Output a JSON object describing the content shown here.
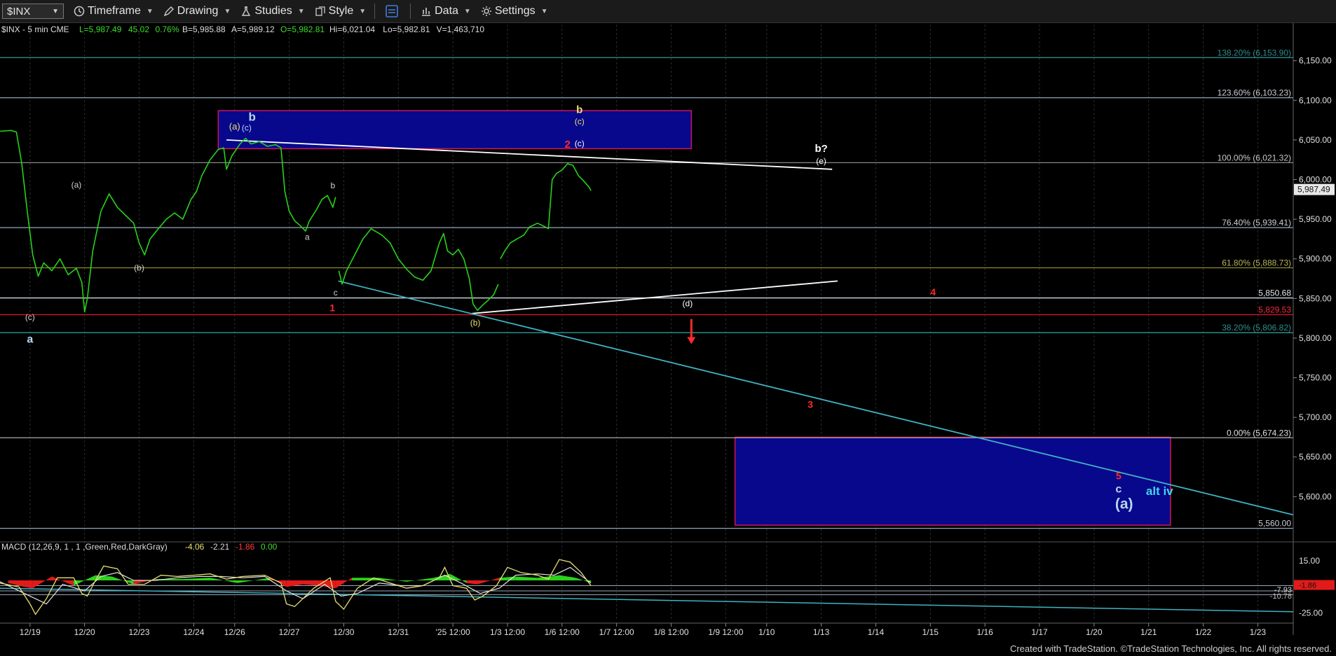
{
  "toolbar": {
    "symbol": "$INX",
    "timeframe": "Timeframe",
    "drawing": "Drawing",
    "studies": "Studies",
    "style": "Style",
    "data": "Data",
    "settings": "Settings"
  },
  "chart_data": {
    "type": "line",
    "header": "$INX - 5 min  CME",
    "stats": [
      {
        "text": "L=5,987.49",
        "color": "#3ddc2a"
      },
      {
        "text": "45.02",
        "color": "#3ddc2a"
      },
      {
        "text": "0.76%",
        "color": "#3ddc2a"
      },
      {
        "text": "B=5,985.88",
        "color": "#dddddd"
      },
      {
        "text": "A=5,989.12",
        "color": "#dddddd"
      },
      {
        "text": "O=5,982.81",
        "color": "#3ddc2a"
      },
      {
        "text": "Hi=6,021.04",
        "color": "#dddddd"
      },
      {
        "text": "Lo=5,982.81",
        "color": "#dddddd"
      },
      {
        "text": "V=1,463,710",
        "color": "#dddddd"
      }
    ],
    "xticks": [
      {
        "label": "12/19",
        "x": 0
      },
      {
        "label": "12/20",
        "x": 1
      },
      {
        "label": "12/23",
        "x": 2
      },
      {
        "label": "12/24",
        "x": 3
      },
      {
        "label": "12/26",
        "x": 3.75
      },
      {
        "label": "12/27",
        "x": 4.75
      },
      {
        "label": "12/30",
        "x": 5.75
      },
      {
        "label": "12/31",
        "x": 6.75
      },
      {
        "label": "'25 12:00",
        "x": 7.75
      },
      {
        "label": "1/3 12:00",
        "x": 8.75
      },
      {
        "label": "1/6 12:00",
        "x": 9.75
      },
      {
        "label": "1/7 12:00",
        "x": 10.75
      },
      {
        "label": "1/8 12:00",
        "x": 11.75
      },
      {
        "label": "1/9 12:00",
        "x": 12.75
      },
      {
        "label": "1/10",
        "x": 13.5
      },
      {
        "label": "1/13",
        "x": 14.5
      },
      {
        "label": "1/14",
        "x": 15.5
      },
      {
        "label": "1/15",
        "x": 16.5
      },
      {
        "label": "1/16",
        "x": 17.5
      },
      {
        "label": "1/17",
        "x": 18.5
      },
      {
        "label": "1/20",
        "x": 19.5
      },
      {
        "label": "1/21",
        "x": 20.5
      },
      {
        "label": "1/22",
        "x": 21.5
      },
      {
        "label": "1/23",
        "x": 22.5
      }
    ],
    "xlim": [
      -0.55,
      23.15
    ],
    "ylim": [
      5542,
      6178
    ],
    "yticks": [
      {
        "label": "6,150.00",
        "y": 6150
      },
      {
        "label": "6,100.00",
        "y": 6100
      },
      {
        "label": "6,050.00",
        "y": 6050
      },
      {
        "label": "6,000.00",
        "y": 6000
      },
      {
        "label": "5,950.00",
        "y": 5950
      },
      {
        "label": "5,900.00",
        "y": 5900
      },
      {
        "label": "5,850.00",
        "y": 5850
      },
      {
        "label": "5,800.00",
        "y": 5800
      },
      {
        "label": "5,750.00",
        "y": 5750
      },
      {
        "label": "5,700.00",
        "y": 5700
      },
      {
        "label": "5,650.00",
        "y": 5650
      },
      {
        "label": "5,600.00",
        "y": 5600
      }
    ],
    "last_price": {
      "label": "5,987.49",
      "y": 5987.49
    },
    "fib_levels": [
      {
        "label": "138.20% (6,153.90)",
        "y": 6153.9,
        "color": "#2a9a98",
        "text_color": "#2f8f8c"
      },
      {
        "label": "123.60% (6,103.23)",
        "y": 6103.23,
        "color": "#8aa6bd",
        "text_color": "#c9ced4"
      },
      {
        "label": "100.00% (6,021.32)",
        "y": 6021.32,
        "color": "#888888",
        "text_color": "#c8c8c8"
      },
      {
        "label": "76.40% (5,939.41)",
        "y": 5939.41,
        "color": "#95a8bc",
        "text_color": "#c9ced4"
      },
      {
        "label": "61.80% (5,888.73)",
        "y": 5888.73,
        "color": "#8e8a2a",
        "text_color": "#b8b35a"
      },
      {
        "label": "5,850.68",
        "y": 5850.68,
        "color": "#cfdbe6",
        "text_color": "#e0e6ec"
      },
      {
        "label": "5,829.53",
        "y": 5829.53,
        "color": "#e3132b",
        "text_color": "#ff2a3b"
      },
      {
        "label": "38.20% (5,806.82)",
        "y": 5806.82,
        "color": "#2a9a98",
        "text_color": "#2f8f8c"
      },
      {
        "label": "0.00% (5,674.23)",
        "y": 5674.23,
        "color": "#9a9a9a",
        "text_color": "#e0e0e0"
      },
      {
        "label": "5,560.00",
        "y": 5560,
        "color": "#8aa6bd",
        "text_color": "#c9ced4"
      }
    ],
    "zones": [
      {
        "x1": 3.45,
        "x2": 12.12,
        "y1": 6039,
        "y2": 6087
      },
      {
        "x1": 12.92,
        "x2": 20.9,
        "y1": 5564,
        "y2": 5675
      }
    ],
    "trendlines": [
      {
        "x1": 3.6,
        "y1": 6050,
        "x2": 14.7,
        "y2": 6013,
        "color": "#ffffff"
      },
      {
        "x1": 8.1,
        "y1": 5831,
        "x2": 14.8,
        "y2": 5872,
        "color": "#ffffff"
      },
      {
        "x1": 5.65,
        "y1": 5872,
        "x2": 23.15,
        "y2": 5577,
        "color": "#3fb2c2"
      }
    ],
    "price": [
      [
        -0.55,
        6061
      ],
      [
        -0.35,
        6062
      ],
      [
        -0.25,
        6060
      ],
      [
        -0.15,
        6020
      ],
      [
        -0.05,
        5960
      ],
      [
        0.05,
        5905
      ],
      [
        0.15,
        5878
      ],
      [
        0.25,
        5895
      ],
      [
        0.4,
        5885
      ],
      [
        0.55,
        5900
      ],
      [
        0.7,
        5880
      ],
      [
        0.85,
        5888
      ],
      [
        0.95,
        5870
      ],
      [
        1.0,
        5833
      ],
      [
        1.05,
        5850
      ],
      [
        1.15,
        5910
      ],
      [
        1.3,
        5960
      ],
      [
        1.45,
        5982
      ],
      [
        1.6,
        5965
      ],
      [
        1.75,
        5955
      ],
      [
        1.9,
        5945
      ],
      [
        2.0,
        5920
      ],
      [
        2.1,
        5905
      ],
      [
        2.2,
        5925
      ],
      [
        2.35,
        5938
      ],
      [
        2.5,
        5950
      ],
      [
        2.65,
        5958
      ],
      [
        2.8,
        5950
      ],
      [
        2.95,
        5975
      ],
      [
        3.05,
        5985
      ],
      [
        3.15,
        6005
      ],
      [
        3.3,
        6025
      ],
      [
        3.45,
        6038
      ],
      [
        3.55,
        6040
      ],
      [
        3.6,
        6013
      ],
      [
        3.7,
        6030
      ],
      [
        3.85,
        6045
      ],
      [
        3.95,
        6052
      ],
      [
        4.05,
        6045
      ],
      [
        4.2,
        6048
      ],
      [
        4.35,
        6042
      ],
      [
        4.5,
        6044
      ],
      [
        4.6,
        6040
      ],
      [
        4.67,
        5985
      ],
      [
        4.75,
        5960
      ],
      [
        4.85,
        5948
      ],
      [
        4.95,
        5942
      ],
      [
        5.05,
        5935
      ],
      [
        5.12,
        5948
      ],
      [
        5.25,
        5962
      ],
      [
        5.35,
        5975
      ],
      [
        5.45,
        5980
      ],
      [
        5.55,
        5965
      ],
      [
        5.6,
        5978
      ],
      [
        5.62,
        5930
      ],
      [
        5.66,
        5885
      ],
      [
        5.72,
        5868
      ],
      [
        5.8,
        5885
      ],
      [
        5.95,
        5905
      ],
      [
        6.1,
        5925
      ],
      [
        6.25,
        5938
      ],
      [
        6.45,
        5930
      ],
      [
        6.6,
        5920
      ],
      [
        6.75,
        5900
      ],
      [
        6.9,
        5887
      ],
      [
        7.05,
        5877
      ],
      [
        7.2,
        5873
      ],
      [
        7.35,
        5885
      ],
      [
        7.5,
        5920
      ],
      [
        7.58,
        5932
      ],
      [
        7.65,
        5910
      ],
      [
        7.75,
        5905
      ],
      [
        7.85,
        5912
      ],
      [
        7.95,
        5900
      ],
      [
        8.05,
        5875
      ],
      [
        8.12,
        5843
      ],
      [
        8.2,
        5835
      ],
      [
        8.3,
        5842
      ],
      [
        8.4,
        5848
      ],
      [
        8.5,
        5855
      ],
      [
        8.58,
        5868
      ],
      [
        8.62,
        5900
      ],
      [
        8.7,
        5910
      ],
      [
        8.8,
        5920
      ],
      [
        8.92,
        5925
      ],
      [
        9.05,
        5930
      ],
      [
        9.15,
        5940
      ],
      [
        9.3,
        5945
      ],
      [
        9.45,
        5940
      ],
      [
        9.5,
        5938
      ],
      [
        9.57,
        6000
      ],
      [
        9.65,
        6008
      ],
      [
        9.75,
        6012
      ],
      [
        9.85,
        6020
      ],
      [
        9.95,
        6018
      ],
      [
        10.05,
        6005
      ],
      [
        10.15,
        5998
      ],
      [
        10.25,
        5990
      ],
      [
        10.28,
        5986
      ]
    ],
    "macd": {
      "title": "MACD (12,26,9, 1 , 1 ,Green,Red,DarkGray)",
      "values": [
        {
          "text": "-4.06",
          "color": "#e8e070"
        },
        {
          "text": "-2.21",
          "color": "#d8d8d8"
        },
        {
          "text": "-1.86",
          "color": "#ff3b3b"
        },
        {
          "text": "0.00",
          "color": "#3ddc2a"
        }
      ],
      "ylim": [
        -30,
        22
      ],
      "yticks": [
        {
          "label": "15.00",
          "y": 15
        },
        {
          "label": "-25.00",
          "y": -25
        }
      ],
      "badge_levels": [
        {
          "label": "-7.93",
          "y": -7.93
        },
        {
          "label": "-10.78",
          "y": -10.78
        },
        {
          "label": "-1.86",
          "y": -1.86
        }
      ],
      "levels": [
        -4,
        -8,
        -11
      ],
      "trend": {
        "x1": -0.55,
        "y1": -6,
        "x2": 23.15,
        "y2": -24
      },
      "line": [
        [
          -0.55,
          -2
        ],
        [
          -0.2,
          -5
        ],
        [
          0.0,
          -18
        ],
        [
          0.1,
          -26
        ],
        [
          0.3,
          -14
        ],
        [
          0.5,
          2
        ],
        [
          0.8,
          2
        ],
        [
          0.95,
          -10
        ],
        [
          1.05,
          -12
        ],
        [
          1.2,
          0
        ],
        [
          1.35,
          11
        ],
        [
          1.6,
          9
        ],
        [
          1.8,
          -3
        ],
        [
          2.1,
          -3
        ],
        [
          2.4,
          4
        ],
        [
          2.7,
          3
        ],
        [
          3.0,
          4
        ],
        [
          3.3,
          5
        ],
        [
          3.6,
          1
        ],
        [
          3.9,
          3
        ],
        [
          4.3,
          4
        ],
        [
          4.6,
          -2
        ],
        [
          4.7,
          -18
        ],
        [
          4.85,
          -20
        ],
        [
          5.2,
          -6
        ],
        [
          5.5,
          2
        ],
        [
          5.6,
          -16
        ],
        [
          5.75,
          -22
        ],
        [
          6.0,
          -6
        ],
        [
          6.3,
          2
        ],
        [
          6.6,
          -2
        ],
        [
          6.9,
          -6
        ],
        [
          7.2,
          -4
        ],
        [
          7.5,
          2
        ],
        [
          7.6,
          10
        ],
        [
          7.75,
          -4
        ],
        [
          8.0,
          -6
        ],
        [
          8.15,
          -15
        ],
        [
          8.3,
          -12
        ],
        [
          8.55,
          -4
        ],
        [
          8.75,
          10
        ],
        [
          9.0,
          6
        ],
        [
          9.3,
          4
        ],
        [
          9.5,
          1
        ],
        [
          9.7,
          16
        ],
        [
          9.9,
          14
        ],
        [
          10.1,
          6
        ],
        [
          10.28,
          -4
        ]
      ],
      "signal": [
        [
          -0.55,
          -1
        ],
        [
          0.0,
          -12
        ],
        [
          0.3,
          -18
        ],
        [
          0.6,
          -3
        ],
        [
          1.0,
          -8
        ],
        [
          1.3,
          3
        ],
        [
          1.6,
          6
        ],
        [
          1.9,
          0
        ],
        [
          2.3,
          0
        ],
        [
          2.7,
          2
        ],
        [
          3.1,
          3
        ],
        [
          3.5,
          3
        ],
        [
          3.9,
          2
        ],
        [
          4.3,
          3
        ],
        [
          4.7,
          -8
        ],
        [
          5.0,
          -14
        ],
        [
          5.4,
          -3
        ],
        [
          5.7,
          -12
        ],
        [
          6.0,
          -10
        ],
        [
          6.4,
          -2
        ],
        [
          6.8,
          -4
        ],
        [
          7.2,
          -4
        ],
        [
          7.6,
          4
        ],
        [
          7.9,
          -2
        ],
        [
          8.25,
          -10
        ],
        [
          8.6,
          -6
        ],
        [
          8.9,
          4
        ],
        [
          9.3,
          5
        ],
        [
          9.6,
          4
        ],
        [
          9.9,
          10
        ],
        [
          10.28,
          -2
        ]
      ],
      "hist": [
        [
          -0.4,
          -2
        ],
        [
          -0.1,
          -5
        ],
        [
          0.05,
          -6
        ],
        [
          0.4,
          3
        ],
        [
          0.8,
          -4
        ],
        [
          1.2,
          4
        ],
        [
          1.5,
          3
        ],
        [
          1.9,
          -3
        ],
        [
          2.3,
          1
        ],
        [
          2.8,
          1
        ],
        [
          3.3,
          2
        ],
        [
          3.8,
          -2
        ],
        [
          4.4,
          2
        ],
        [
          4.7,
          -5
        ],
        [
          5.0,
          -3
        ],
        [
          5.3,
          -4
        ],
        [
          5.6,
          -6
        ],
        [
          5.9,
          2
        ],
        [
          6.4,
          2
        ],
        [
          6.9,
          -1
        ],
        [
          7.4,
          2
        ],
        [
          7.7,
          5
        ],
        [
          8.0,
          -2
        ],
        [
          8.2,
          -3
        ],
        [
          8.6,
          2
        ],
        [
          8.9,
          3
        ],
        [
          9.3,
          2
        ],
        [
          9.7,
          4
        ],
        [
          10.0,
          2
        ],
        [
          10.28,
          -2
        ]
      ]
    },
    "annotations": [
      {
        "text": "a",
        "x": 0.0,
        "y": 5794,
        "color": "#b7d6f0",
        "size": 16,
        "bold": true
      },
      {
        "text": "(c)",
        "x": 0.0,
        "y": 5823,
        "color": "#cfcfcf",
        "size": 12
      },
      {
        "text": "(a)",
        "x": 0.85,
        "y": 5990,
        "color": "#cfcfcf",
        "size": 12
      },
      {
        "text": "(b)",
        "x": 2.0,
        "y": 5885,
        "color": "#cfcfcf",
        "size": 12
      },
      {
        "text": "(a)",
        "x": 3.75,
        "y": 6063,
        "color": "#e8e070",
        "size": 13
      },
      {
        "text": "(c)",
        "x": 3.97,
        "y": 6062,
        "color": "#b7d6f0",
        "size": 12
      },
      {
        "text": "b",
        "x": 4.07,
        "y": 6074,
        "color": "#b7d6f0",
        "size": 17,
        "bold": true
      },
      {
        "text": "b",
        "x": 5.55,
        "y": 5989,
        "color": "#cfcfcf",
        "size": 12
      },
      {
        "text": "a",
        "x": 5.08,
        "y": 5924,
        "color": "#cfcfcf",
        "size": 12
      },
      {
        "text": "c",
        "x": 5.6,
        "y": 5854,
        "color": "#cfcfcf",
        "size": 12
      },
      {
        "text": "1",
        "x": 5.54,
        "y": 5834,
        "color": "#ff2a2a",
        "size": 14,
        "bold": true
      },
      {
        "text": "(b)",
        "x": 8.16,
        "y": 5816,
        "color": "#e8e070",
        "size": 12
      },
      {
        "text": "b",
        "x": 10.07,
        "y": 6084,
        "color": "#e8e070",
        "size": 15,
        "bold": true
      },
      {
        "text": "(c)",
        "x": 10.07,
        "y": 6070,
        "color": "#e8e070",
        "size": 12
      },
      {
        "text": "2",
        "x": 9.85,
        "y": 6040,
        "color": "#ff2a2a",
        "size": 15,
        "bold": true
      },
      {
        "text": "(c)",
        "x": 10.07,
        "y": 6042,
        "color": "#ffffff",
        "size": 12
      },
      {
        "text": "b?",
        "x": 14.5,
        "y": 6035,
        "color": "#ffffff",
        "size": 15,
        "bold": true
      },
      {
        "text": "(e)",
        "x": 14.5,
        "y": 6020,
        "color": "#ffffff",
        "size": 12
      },
      {
        "text": "(d)",
        "x": 12.05,
        "y": 5840,
        "color": "#ffffff",
        "size": 12
      },
      {
        "text": "4",
        "x": 16.55,
        "y": 5854,
        "color": "#ff2a2a",
        "size": 14,
        "bold": true
      },
      {
        "text": "3",
        "x": 14.3,
        "y": 5712,
        "color": "#ff2a2a",
        "size": 14,
        "bold": true
      },
      {
        "text": "5",
        "x": 19.95,
        "y": 5622,
        "color": "#ff2a2a",
        "size": 14,
        "bold": true
      },
      {
        "text": "c",
        "x": 19.95,
        "y": 5605,
        "color": "#b7d6f0",
        "size": 16,
        "bold": true
      },
      {
        "text": "(a)",
        "x": 20.05,
        "y": 5585,
        "color": "#b7d6f0",
        "size": 21,
        "bold": true
      },
      {
        "text": "alt iv",
        "x": 20.7,
        "y": 5602,
        "color": "#3fd6ea",
        "size": 17,
        "bold": true
      }
    ],
    "arrow": {
      "x": 12.12,
      "y_top": 5824,
      "y_bottom": 5796,
      "color": "#ff2a2a"
    }
  },
  "footer": "Created with TradeStation. ©TradeStation Technologies, Inc. All rights reserved."
}
